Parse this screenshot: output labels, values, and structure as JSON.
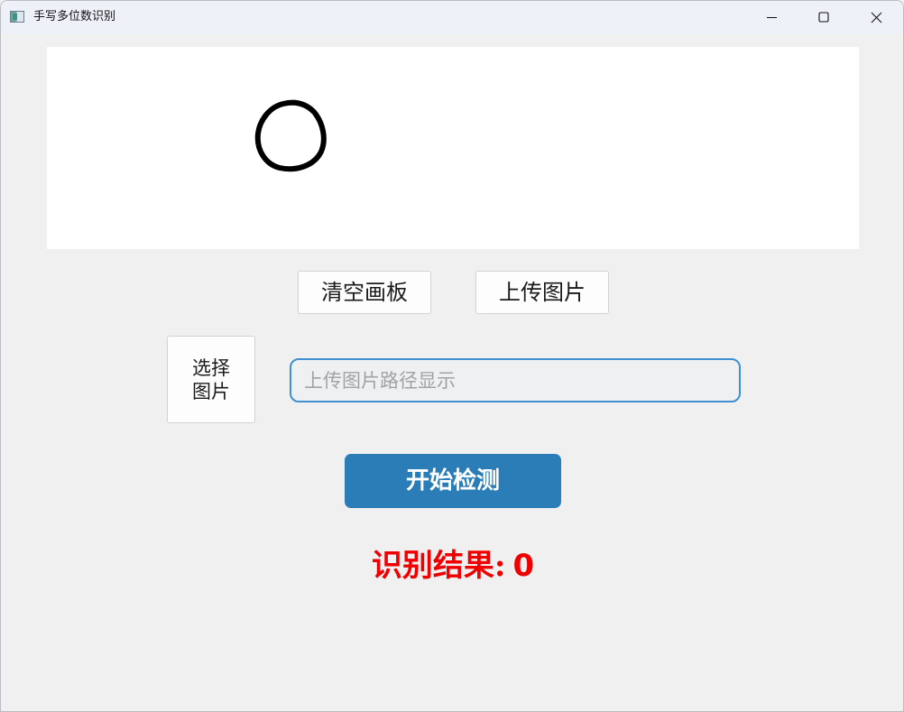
{
  "window": {
    "title": "手写多位数识别",
    "icon": "app-window-icon"
  },
  "titlebar_buttons": {
    "minimize": "minimize-icon",
    "maximize": "maximize-icon",
    "close": "close-icon"
  },
  "canvas": {
    "drawn_content": "handwritten digit 0"
  },
  "buttons": {
    "clear_label": "清空画板",
    "upload_label": "上传图片",
    "select_line1": "选择",
    "select_line2": "图片",
    "detect_label": "开始检测"
  },
  "path_input": {
    "value": "",
    "placeholder": "上传图片路径显示"
  },
  "result": {
    "label": "识别结果:",
    "value": "0"
  },
  "colors": {
    "detect_button": "#2b7db8",
    "result_text": "#f00000",
    "input_border": "#3f90d0"
  }
}
